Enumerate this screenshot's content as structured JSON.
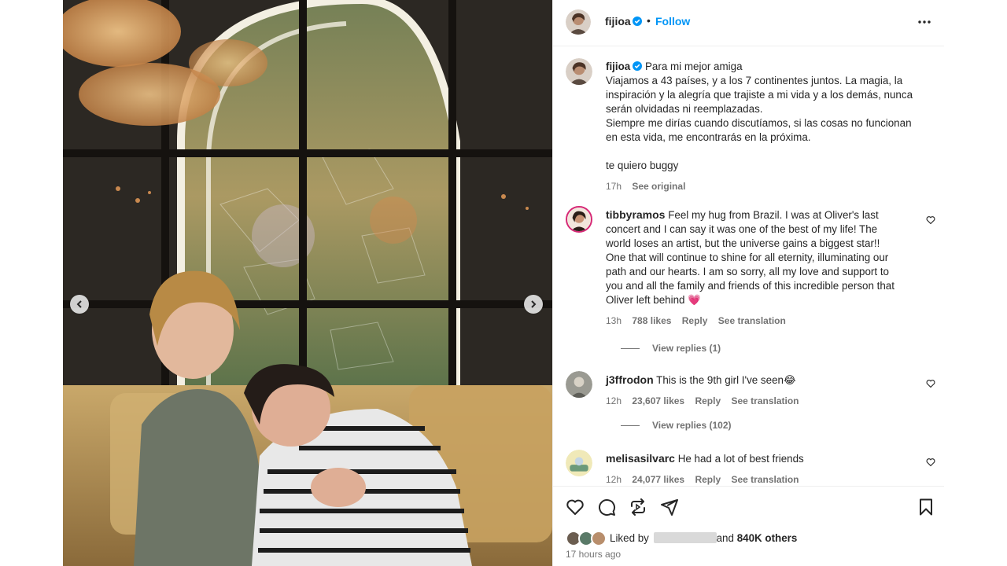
{
  "post": {
    "username": "fijioa",
    "follow_label": "Follow",
    "dot": "•"
  },
  "caption": {
    "username": "fijioa",
    "lines": [
      "Para mi mejor amiga",
      "Viajamos a 43 países, y a los 7 continentes juntos. La magia, la",
      "inspiración y la alegría que trajiste a mi vida y a los demás, nunca",
      "serán olvidadas ni reemplazadas.",
      "Siempre me dirías cuando discutíamos, si las cosas no funcionan",
      "en esta vida, me encontrarás en la próxima.",
      "",
      "te quiero buggy"
    ],
    "time": "17h",
    "see_original": "See original"
  },
  "comments": [
    {
      "username": "tibbyramos",
      "lines": [
        "Feel my hug from Brazil. I was at Oliver's last",
        "concert and I can say it was one of the best of my life! The",
        "world loses an artist, but the universe gains a biggest star!!",
        "One that will continue to shine for all eternity, illuminating our",
        "path and our hearts. I am so sorry, all my love and support to",
        "you and all the family and friends of this incredible person that",
        "Oliver left behind"
      ],
      "emoji": "💗",
      "time": "13h",
      "likes": "788 likes",
      "reply": "Reply",
      "translate": "See translation",
      "view_replies": "View replies (1)"
    },
    {
      "username": "j3ffrodon",
      "lines": [
        "This is the 9th girl I've seen"
      ],
      "emoji": "😂",
      "time": "12h",
      "likes": "23,607 likes",
      "reply": "Reply",
      "translate": "See translation",
      "view_replies": "View replies (102)"
    },
    {
      "username": "melisasilvarc",
      "lines": [
        "He had a lot of best friends"
      ],
      "emoji": "",
      "time": "12h",
      "likes": "24,077 likes",
      "reply": "Reply",
      "translate": "See translation"
    }
  ],
  "likes_bar": {
    "liked_by": "Liked by",
    "and_label": "and",
    "others": "840K others",
    "time_ago": "17 hours ago"
  },
  "icons": {
    "header_more": "more-horizontal-icon",
    "verified": "verified-badge-icon",
    "actions": [
      "heart-icon",
      "comment-icon",
      "share-icon",
      "send-icon",
      "bookmark-icon"
    ],
    "media_nav": [
      "chevron-left-icon",
      "chevron-right-icon"
    ]
  },
  "colors": {
    "accent": "#0095f6",
    "muted": "#737373",
    "text": "#262626",
    "border": "#efefef"
  }
}
